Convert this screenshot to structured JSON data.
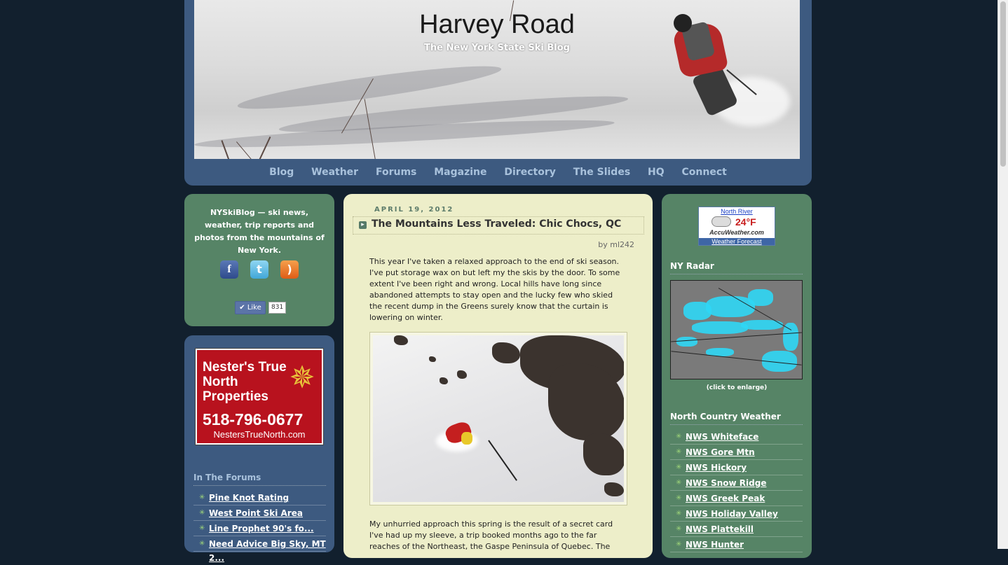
{
  "header": {
    "title": "Harvey Road",
    "subtitle": "The New York State Ski Blog",
    "nav": [
      "Blog",
      "Weather",
      "Forums",
      "Magazine",
      "Directory",
      "The Slides",
      "HQ",
      "Connect"
    ]
  },
  "left": {
    "tagline": "NYSkiBlog — ski news, weather, trip reports and photos from the mountains of New York.",
    "social_icons": [
      "facebook-icon",
      "twitter-icon",
      "rss-icon"
    ],
    "like_label": "Like",
    "like_count": "831",
    "ad": {
      "name": "Nester's True North Properties",
      "phone": "518-796-0677",
      "url": "NestersTrueNorth.com"
    },
    "forums_heading": "In The Forums",
    "forums": [
      "Pine Knot Rating",
      "West Point Ski Area",
      "Line Prophet 90's fo...",
      "Need Advice Big Sky, MT 2..."
    ]
  },
  "post": {
    "date": "APRIL 19, 2012",
    "title": "The Mountains Less Traveled: Chic Chocs, QC",
    "author": "by ml242",
    "para1": "This year I've taken a relaxed approach to the end of ski season. I've put storage wax on but left my the skis by the door. To some extent I've been right and wrong. Local hills have long since abandoned attempts to stay open and the lucky few who skied the recent dump in the Greens surely know that the curtain is lowering on winter.",
    "para2": "My unhurried approach this spring is the result of a secret card I've had up my sleeve, a trip booked months ago to the far reaches of the Northeast, the Gaspe Peninsula of Quebec. The"
  },
  "right": {
    "weather": {
      "location": "North River",
      "temp": "24°F",
      "brand": "AccuWeather.com",
      "forecast_label": "Weather Forecast"
    },
    "radar_heading": "NY Radar",
    "radar_caption": "(click to enlarge)",
    "nc_heading": "North Country Weather",
    "nc_links": [
      "NWS Whiteface",
      "NWS Gore Mtn",
      "NWS Hickory",
      "NWS Snow Ridge",
      "NWS Greek Peak",
      "NWS Holiday Valley",
      "NWS Plattekill",
      "NWS Hunter"
    ]
  },
  "colors": {
    "background": "#12202e",
    "blue_panel": "#3d5a80",
    "green_panel": "#568466",
    "content_bg": "#edeec9",
    "nav_text": "#a9c2dc"
  }
}
